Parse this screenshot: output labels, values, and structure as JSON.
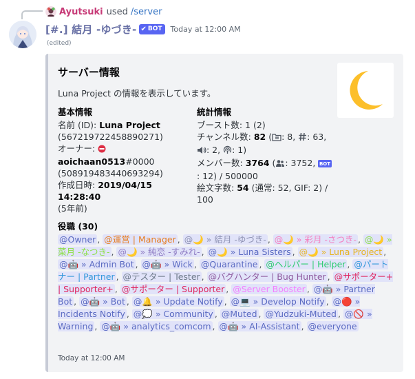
{
  "reply": {
    "username": "Ayutsuki",
    "used_text": "used",
    "command": "/server"
  },
  "message": {
    "author": "[#.] 結月 -ゆづき-",
    "bot_tag": "BOT",
    "timestamp": "Today at 12:00 AM",
    "edited": "(edited)"
  },
  "embed": {
    "accent_color": "#c7cbd6",
    "title": "サーバー情報",
    "description": "Luna Project の情報を表示しています。",
    "thumbnail_icon": "crescent-moon",
    "thumbnail_color": "#fcbf2a",
    "fields": {
      "basic": {
        "name": "基本情報",
        "name_label": "名前 (ID): ",
        "name_value": "Luna Project",
        "name_id": "(567219722458890271)",
        "owner_label": "オーナー: ",
        "owner_name": "aoichaan0513",
        "owner_tag": "#0000",
        "owner_id": "(508919483440693294)",
        "created_label": "作成日時: ",
        "created_value": "2019/04/15 14:28:40",
        "created_ago": "(5年前)"
      },
      "stats": {
        "name": "統計情報",
        "boosts": "ブースト数: 1 (2)",
        "channels_label": "チャンネル数: ",
        "channels_total": "82",
        "channels_category": ": 8, ",
        "channels_text": "63, ",
        "channels_voice": ": 2, ",
        "channels_stage": ": 1)",
        "members_label": "メンバー数: ",
        "members_total": "3764",
        "members_users": ": 3752, ",
        "members_bots": ": 12) / 500000",
        "emoji_label": "絵文字数: ",
        "emoji_total": "54",
        "emoji_detail": " (通常: 52, GIF: 2) / 100"
      }
    },
    "roles": {
      "title": "役職 (30)",
      "items": [
        {
          "text": "@Owner",
          "color": "#5b6bc2"
        },
        {
          "text": "@運営 | Manager",
          "color": "#e67e22"
        },
        {
          "text": "@🌙 » 結月 -ゆづき-",
          "color": "#8e92b3"
        },
        {
          "text": "@🌙 » 彩月 -さつき-",
          "color": "#f47fbf"
        },
        {
          "text": "@🌙 » 菜月 -なつき-",
          "color": "#8ee04a"
        },
        {
          "text": "@🌙 » 純恋 -すみれ-",
          "color": "#8e7cc3"
        },
        {
          "text": "@🌙 » Luna Sisters",
          "color": "#5b6bc2"
        },
        {
          "text": "@🌙 » Luna Project",
          "color": "#e6b422"
        },
        {
          "text": "@🤖 » Admin Bot",
          "color": "#5b6bc2"
        },
        {
          "text": "@🤖 » Wick",
          "color": "#5b6bc2"
        },
        {
          "text": "@Quarantine",
          "color": "#5b6bc2"
        },
        {
          "text": "@ヘルパー | Helper",
          "color": "#2ecc71"
        },
        {
          "text": "@パートナー | Partner",
          "color": "#3498db"
        },
        {
          "text": "@テスター | Tester",
          "color": "#6e7a8a"
        },
        {
          "text": "@バグハンター | Bug Hunter",
          "color": "#8e5a9e"
        },
        {
          "text": "@サポーター+ | Supporter+",
          "color": "#e0245e"
        },
        {
          "text": "@サポーター | Supporter",
          "color": "#e0245e"
        },
        {
          "text": "@Server Booster",
          "color": "#f47fff"
        },
        {
          "text": "@🤖 » Partner Bot",
          "color": "#5b6bc2"
        },
        {
          "text": "@🤖 » Bot",
          "color": "#5b6bc2"
        },
        {
          "text": "@🔔 » Update Notify",
          "color": "#5b6bc2"
        },
        {
          "text": "@💻 » Develop Notify",
          "color": "#5b6bc2"
        },
        {
          "text": "@🔴 » Incidents Notify",
          "color": "#5b6bc2"
        },
        {
          "text": "@💭 » Community",
          "color": "#5b6bc2"
        },
        {
          "text": "@Muted",
          "color": "#5b6bc2"
        },
        {
          "text": "@Yudzuki-Muted",
          "color": "#5b6bc2"
        },
        {
          "text": "@🚫 » Warning",
          "color": "#5b6bc2"
        },
        {
          "text": "@🤖 » analytics_comcom",
          "color": "#5b6bc2"
        },
        {
          "text": "@🤖 » AI-Assistant",
          "color": "#5b6bc2"
        },
        {
          "text": "@everyone",
          "color": "#5b6bc2"
        }
      ]
    },
    "footer": "Today at 12:00 AM"
  }
}
